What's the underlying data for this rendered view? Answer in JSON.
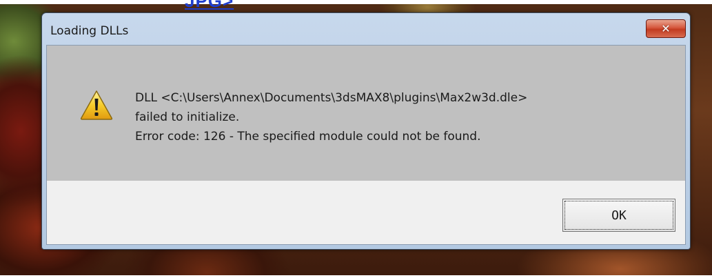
{
  "background": {
    "link_fragment": "JPG>"
  },
  "dialog": {
    "title": "Loading DLLs",
    "close_glyph": "✕",
    "icon": "warning-icon",
    "message_lines": [
      "DLL <C:\\Users\\Annex\\Documents\\3dsMAX8\\plugins\\Max2w3d.dle>",
      "failed to initialize.",
      "Error code: 126 - The specified module could not be found."
    ],
    "ok_label": "OK"
  },
  "colors": {
    "close_button": "#c23b20",
    "titlebar": "#c7d8ec",
    "content_bg": "#c0c0c0",
    "button_area_bg": "#f0f0f0",
    "link": "#1f3ecf"
  }
}
